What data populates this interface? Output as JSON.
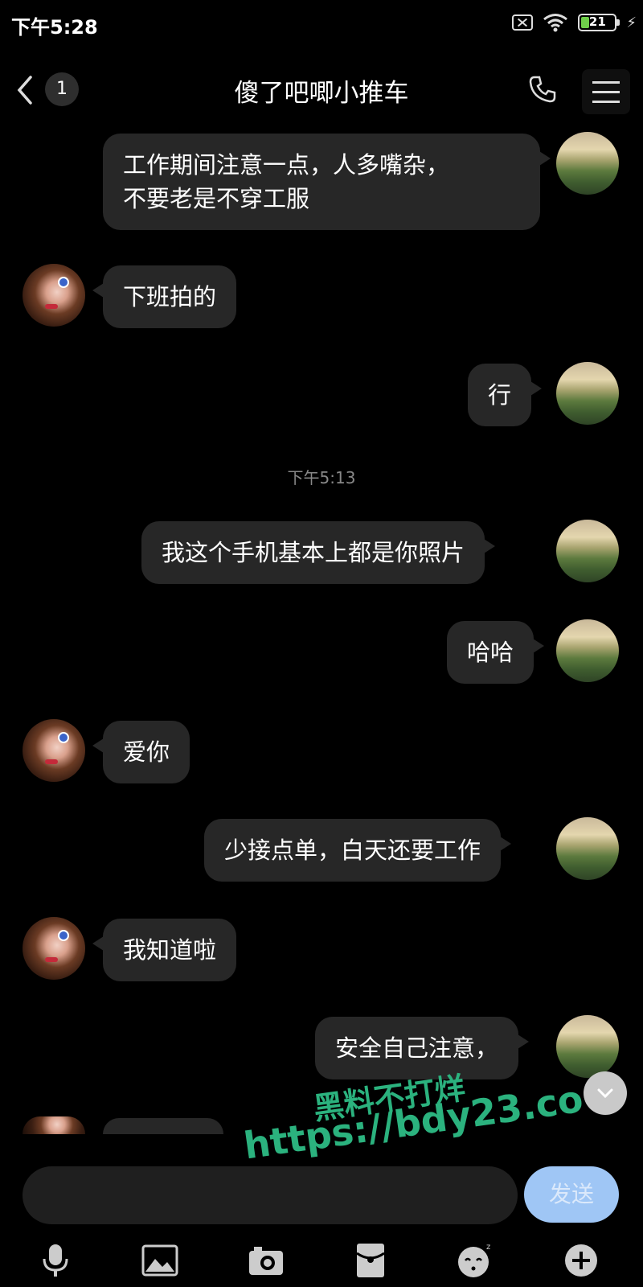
{
  "status_bar": {
    "time": "下午5:28",
    "battery": "21",
    "icons": [
      "sim-off-icon",
      "wifi-icon",
      "battery-icon",
      "charging-bolt-icon"
    ]
  },
  "header": {
    "back_icon": "chevron-left-icon",
    "unread_count": "1",
    "title": "傻了吧唧小推车",
    "call_icon": "phone-icon",
    "menu_icon": "hamburger-menu-icon"
  },
  "messages": [
    {
      "sender": "self",
      "text_lines": [
        "工作期间注意一点，人多嘴杂，",
        "不要老是不穿工服"
      ]
    },
    {
      "sender": "other",
      "text": "下班拍的"
    },
    {
      "sender": "self",
      "text": "行"
    },
    {
      "sender": "self",
      "text": "我这个手机基本上都是你照片"
    },
    {
      "sender": "self",
      "text": "哈哈"
    },
    {
      "sender": "other",
      "text": "爱你"
    },
    {
      "sender": "self",
      "text": "少接点单，白天还要工作"
    },
    {
      "sender": "other",
      "text": "我知道啦"
    },
    {
      "sender": "self",
      "text": "安全自己注意，"
    }
  ],
  "timestamp": "下午5:13",
  "watermark": {
    "line1": "黑料不打烊",
    "line2": "https://bdy23.co"
  },
  "composer": {
    "input_value": "",
    "send_label": "发送",
    "send_color": "#9fc6f5"
  },
  "toolbar": [
    "microphone-icon",
    "image-icon",
    "camera-icon",
    "red-packet-icon",
    "emoji-icon",
    "plus-icon"
  ],
  "colors": {
    "background": "#000000",
    "bubble": "#272727",
    "watermark": "#2bb27e"
  }
}
